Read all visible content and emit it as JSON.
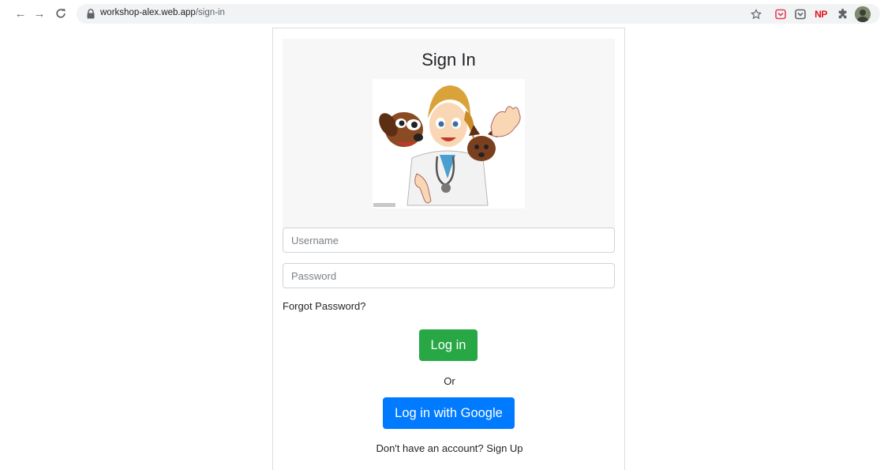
{
  "browser": {
    "url_host": "workshop-alex.web.app",
    "url_path": "/sign-in",
    "back_glyph": "←",
    "forward_glyph": "→",
    "extension_np_label": "NP"
  },
  "icons": {
    "back": "arrow-left-icon",
    "forward": "arrow-right-icon",
    "reload": "reload-icon",
    "lock": "lock-icon",
    "star": "star-icon",
    "pocket": "pocket-icon",
    "puzzle": "puzzle-icon",
    "avatar": "avatar"
  },
  "signin": {
    "title": "Sign In",
    "username_placeholder": "Username",
    "password_placeholder": "Password",
    "forgot_password": "Forgot Password?",
    "login_button": "Log in",
    "or_text": "Or",
    "google_button": "Log in with Google",
    "no_account_text": "Don't have an account?",
    "signup_link": "Sign Up"
  },
  "colors": {
    "login_green": "#28a745",
    "google_blue": "#007bff",
    "header_gray": "#f7f7f7",
    "np_red": "#e3101e"
  }
}
